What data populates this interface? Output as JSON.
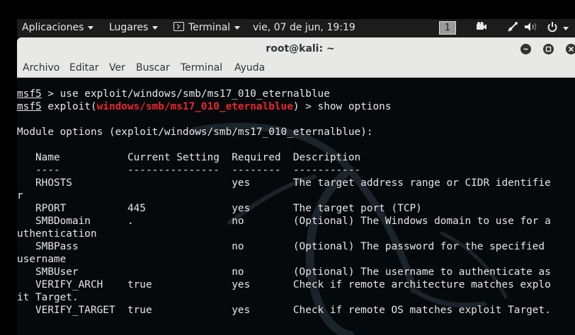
{
  "topbar": {
    "applications": "Aplicaciones",
    "places": "Lugares",
    "terminal_app": "Terminal",
    "clock": "vie, 07 de jun, 19:19",
    "workspace": "1",
    "icons": [
      "camera-icon",
      "wifi-icon",
      "volume-icon",
      "power-icon",
      "chevron-down-icon"
    ]
  },
  "window": {
    "title": "root@kali: ~",
    "buttons": [
      "minimize",
      "maximize",
      "close"
    ]
  },
  "menubar": {
    "items": [
      "Archivo",
      "Editar",
      "Ver",
      "Buscar",
      "Terminal",
      "Ayuda"
    ]
  },
  "terminal": {
    "prompt": "msf5",
    "cmd1": " > use exploit/windows/smb/ms17_010_eternalblue",
    "cmd2_prefix": " exploit(",
    "module": "windows/smb/ms17_010_eternalblue",
    "cmd2_suffix": ") > show options",
    "section_header": "Module options (exploit/windows/smb/ms17_010_eternalblue):",
    "table_header": "   Name           Current Setting  Required  Description",
    "table_rule": "   ----           ---------------  --------  -----------",
    "rows": [
      "   RHOSTS                          yes       The target address range or CIDR identifie",
      "r",
      "   RPORT          445              yes       The target port (TCP)",
      "   SMBDomain      .                no        (Optional) The Windows domain to use for a",
      "uthentication",
      "   SMBPass                         no        (Optional) The password for the specified",
      "username",
      "   SMBUser                         no        (Optional) The username to authenticate as",
      "   VERIFY_ARCH    true             yes       Check if remote architecture matches explo",
      "it Target.",
      "   VERIFY_TARGET  true             yes       Check if remote OS matches exploit Target."
    ]
  },
  "colors": {
    "terminal_bg": "#06090c",
    "terminal_fg": "#e6e6e6",
    "module_highlight": "#e8262b",
    "topbar_bg": "#1c1c1c",
    "titlebar_bg": "#e8e8e7"
  }
}
